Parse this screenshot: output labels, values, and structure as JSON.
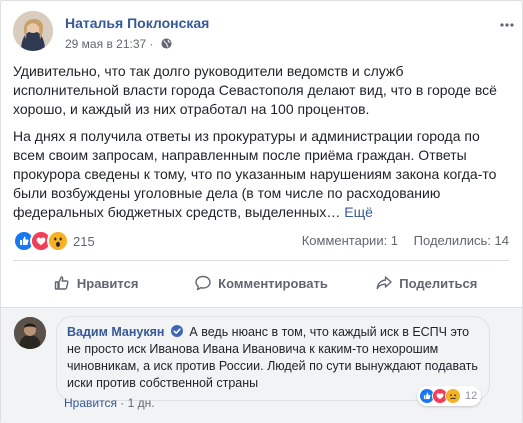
{
  "post": {
    "author": "Наталья Поклонская",
    "date": "29 мая в 21:37",
    "meta_sep": " · ",
    "paragraph1": "Удивительно, что так долго руководители ведомств и служб исполнительной власти города Севастополя делают вид, что в городе всё хорошо, и каждый из них отработал на 100 процентов.",
    "paragraph2": "На днях я получила ответы из прокуратуры и администрации города по всем своим запросам, направленным после приёма граждан. Ответы прокурора сведены к тому, что по указанным нарушениям закона когда-то были возбуждены уголовные дела (в том числе по расходованию федеральных бюджетных средств, выделенных…",
    "more_label": "Ещё"
  },
  "stats": {
    "reactions_count": "215",
    "comments": "Комментарии: 1",
    "shares": "Поделились: 14",
    "reaction_icons": [
      "like-icon",
      "love-icon",
      "wow-icon"
    ]
  },
  "actions": {
    "like": "Нравится",
    "comment": "Комментировать",
    "share": "Поделиться"
  },
  "comment": {
    "author": "Вадим Манукян",
    "text": "А ведь нюанс в том, что каждый иск в ЕСПЧ это не просто иск Иванова Ивана Ивановича к каким-то нехорошим чиновникам, а иск против России. Людей по сути вынуждают подавать иски против собственной страны",
    "reactions_count": "12",
    "reaction_icons": [
      "like-icon",
      "love-icon",
      "sad-icon"
    ],
    "like_label": "Нравится",
    "sep": " · ",
    "time": "1 дн."
  },
  "colors": {
    "link": "#385898",
    "like_blue": "#1877f2",
    "love_red": "#f33e58",
    "wow_yellow": "#f7b125"
  }
}
